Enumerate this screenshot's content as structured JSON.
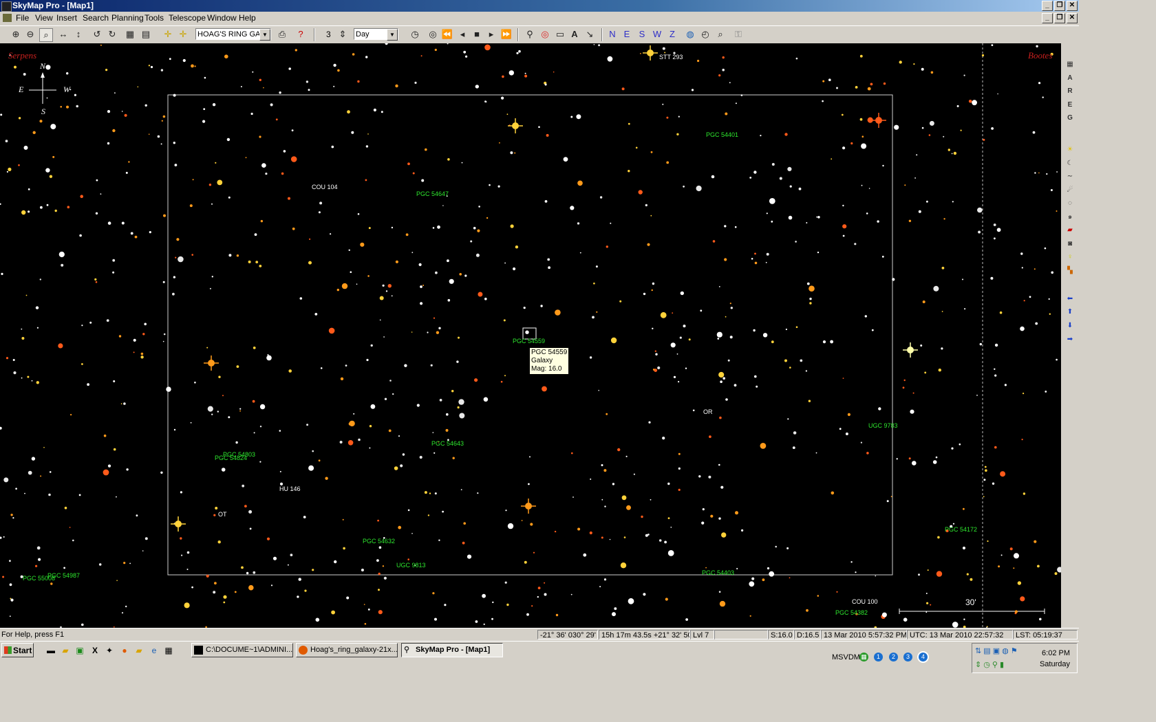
{
  "window": {
    "title": "SkyMap Pro - [Map1]"
  },
  "menu": [
    "File",
    "View",
    "Insert",
    "Search",
    "Planning",
    "Tools",
    "Telescope",
    "Window",
    "Help"
  ],
  "toolbar": {
    "object_select": "HOAG'S RING GAL",
    "step_value": "3",
    "time_unit": "Day",
    "directions": [
      "N",
      "E",
      "S",
      "W",
      "Z"
    ]
  },
  "map": {
    "constellations": {
      "left": "Serpens",
      "right": "Bootes"
    },
    "compass": {
      "n": "N",
      "e": "E",
      "w": "W",
      "s": "S"
    },
    "star_labels": [
      {
        "text": "STT 293"
      },
      {
        "text": "COU 104"
      },
      {
        "text": "OR"
      },
      {
        "text": "HU 146"
      },
      {
        "text": "OT"
      },
      {
        "text": "COU 100"
      }
    ],
    "galaxy_labels": [
      {
        "text": "PGC 54401"
      },
      {
        "text": "PGC 54647"
      },
      {
        "text": "PGC 54559"
      },
      {
        "text": "UGC 9783"
      },
      {
        "text": "PGC 54643"
      },
      {
        "text": "PGC 54803"
      },
      {
        "text": "PGC 54824"
      },
      {
        "text": "PGC 54632"
      },
      {
        "text": "UGC 9813"
      },
      {
        "text": "PGC 54403"
      },
      {
        "text": "PGC 54172"
      },
      {
        "text": "PGC 55008"
      },
      {
        "text": "PGC 54987"
      },
      {
        "text": "PGC 54382"
      }
    ],
    "tooltip": {
      "name": "PGC 54559",
      "type": "Galaxy",
      "mag": "Mag: 16.0"
    },
    "scale_label": "30'"
  },
  "statusbar": {
    "help": "For Help, press F1",
    "altaz": "-21° 36'  030° 29'",
    "radec": "15h 17m 43.5s  +21° 32' 50\"",
    "level": "Lvl 7",
    "mag_s": "S:16.0",
    "mag_d": "D:16.5",
    "local_time": "13 Mar 2010 5:57:32 PM",
    "utc": "UTC: 13 Mar 2010 22:57:32",
    "lst": "LST: 05:19:37"
  },
  "taskbar": {
    "start": "Start",
    "tasks": [
      "C:\\DOCUME~1\\ADMINI...",
      "Hoag's_ring_galaxy-21x...",
      "SkyMap Pro - [Map1]"
    ],
    "msvdm": "MSVDM",
    "desktops": [
      "1",
      "2",
      "3",
      "4"
    ],
    "time": "6:02 PM",
    "day": "Saturday"
  },
  "colors": {
    "title_start": "#0a246a",
    "sky": "#000000",
    "galaxy_label": "#2ee82e",
    "constellation": "#c8201e",
    "tooltip_bg": "#ffffe1"
  }
}
